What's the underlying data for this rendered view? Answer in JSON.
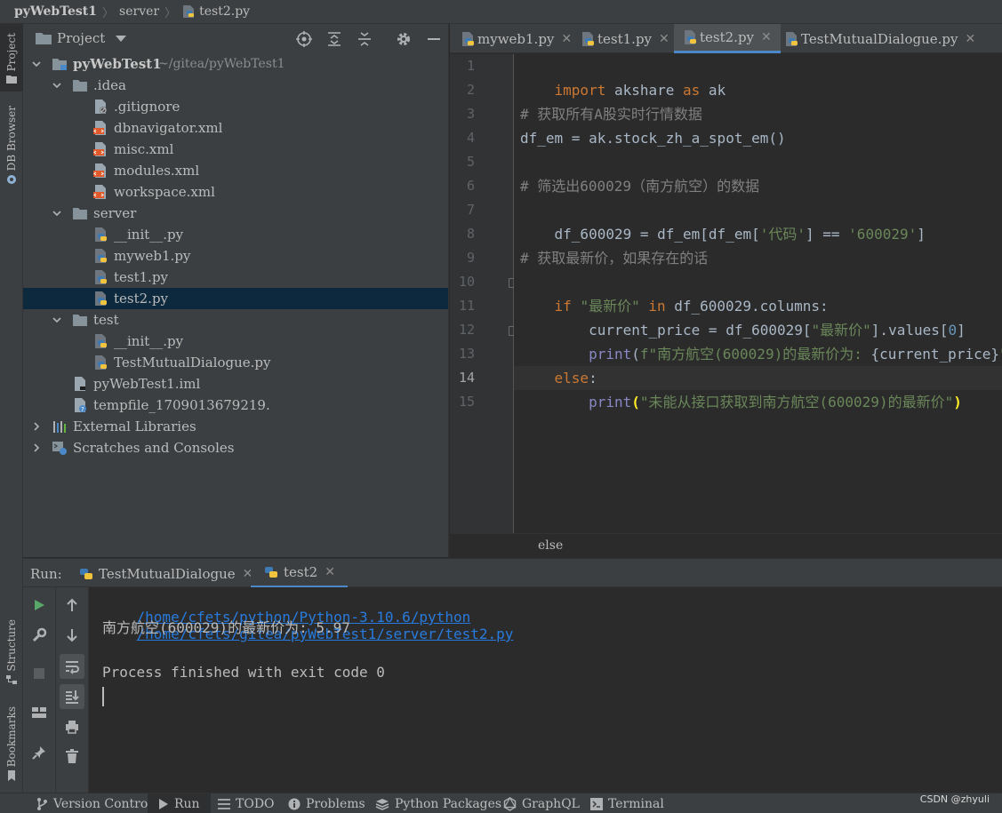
{
  "breadcrumb": {
    "root": "pyWebTest1",
    "folder": "server",
    "file": "test2.py"
  },
  "left_strip": {
    "project": "Project",
    "db_browser": "DB Browser",
    "structure": "Structure",
    "bookmarks": "Bookmarks"
  },
  "project_panel": {
    "title": "Project",
    "tree": [
      {
        "label": "pyWebTest1",
        "path": "~/gitea/pyWebTest1"
      },
      {
        "label": ".idea"
      },
      {
        "label": ".gitignore"
      },
      {
        "label": "dbnavigator.xml"
      },
      {
        "label": "misc.xml"
      },
      {
        "label": "modules.xml"
      },
      {
        "label": "workspace.xml"
      },
      {
        "label": "server"
      },
      {
        "label": "__init__.py"
      },
      {
        "label": "myweb1.py"
      },
      {
        "label": "test1.py"
      },
      {
        "label": "test2.py"
      },
      {
        "label": "test"
      },
      {
        "label": "__init__.py"
      },
      {
        "label": "TestMutualDialogue.py"
      },
      {
        "label": "pyWebTest1.iml"
      },
      {
        "label": "tempfile_1709013679219."
      },
      {
        "label": "External  Libraries"
      },
      {
        "label": "Scratches  and  Consoles"
      }
    ]
  },
  "editor": {
    "tabs": [
      {
        "label": "myweb1.py"
      },
      {
        "label": "test1.py"
      },
      {
        "label": "test2.py"
      },
      {
        "label": "TestMutualDialogue.py"
      }
    ],
    "line_numbers": [
      "1",
      "2",
      "3",
      "4",
      "5",
      "6",
      "7",
      "8",
      "9",
      "10",
      "11",
      "12",
      "13",
      "14",
      "15"
    ],
    "code": {
      "l1": {
        "kw1": "import",
        "t1": " akshare ",
        "kw2": "as",
        "t2": " ak"
      },
      "l3": "# 获取所有A股实时行情数据",
      "l4": "df_em = ak.stock_zh_a_spot_em()",
      "l6": "# 筛选出600029（南方航空）的数据",
      "l7": {
        "t1": "df_600029 = df_em[df_em[",
        "s1": "'代码'",
        "t2": "] == ",
        "s2": "'600029'",
        "t3": "]"
      },
      "l9": "# 获取最新价，如果存在的话",
      "l10": {
        "kw1": "if ",
        "s1": "\"最新价\"",
        "kw2": " in",
        "t1": " df_600029.columns:"
      },
      "l11": {
        "t1": "    current_price = df_600029[",
        "s1": "\"最新价\"",
        "t2": "].values[",
        "n1": "0",
        "t3": "]"
      },
      "l12": {
        "indent": "    ",
        "b1": "print",
        "t1": "(",
        "s1": "f\"南方航空(600029)的最新价为: ",
        "f1": "{current_price}",
        "s2": "\"",
        "t2": ")"
      },
      "l13": {
        "kw1": "else",
        "t1": ":"
      },
      "l14": {
        "indent": "    ",
        "b1": "print",
        "p1": "(",
        "s1": "\"未能从接口获取到南方航空(600029)的最新价\"",
        "p2": ")"
      }
    },
    "footer": "else"
  },
  "run_panel": {
    "label": "Run:",
    "tabs": [
      {
        "label": "TestMutualDialogue"
      },
      {
        "label": "test2"
      }
    ],
    "console": {
      "interpreter": "/home/cfets/python/Python-3.10.6/python",
      "script": "/home/cfets/gitea/pyWebTest1/server/test2.py",
      "output": "南方航空(600029)的最新价为: 5.97",
      "exit": "Process finished with exit code 0"
    }
  },
  "bottom_bar": {
    "items": [
      {
        "label": "Version  Control"
      },
      {
        "label": "Run"
      },
      {
        "label": "TODO"
      },
      {
        "label": "Problems"
      },
      {
        "label": "Python  Packages"
      },
      {
        "label": "GraphQL"
      },
      {
        "label": "Terminal"
      }
    ],
    "watermark": "CSDN @zhyuli"
  },
  "colors": {
    "accent": "#4a88c7",
    "selection": "#0d293e",
    "keyword": "#cc7832",
    "string": "#6a8759",
    "comment": "#808080",
    "link": "#287bde"
  }
}
